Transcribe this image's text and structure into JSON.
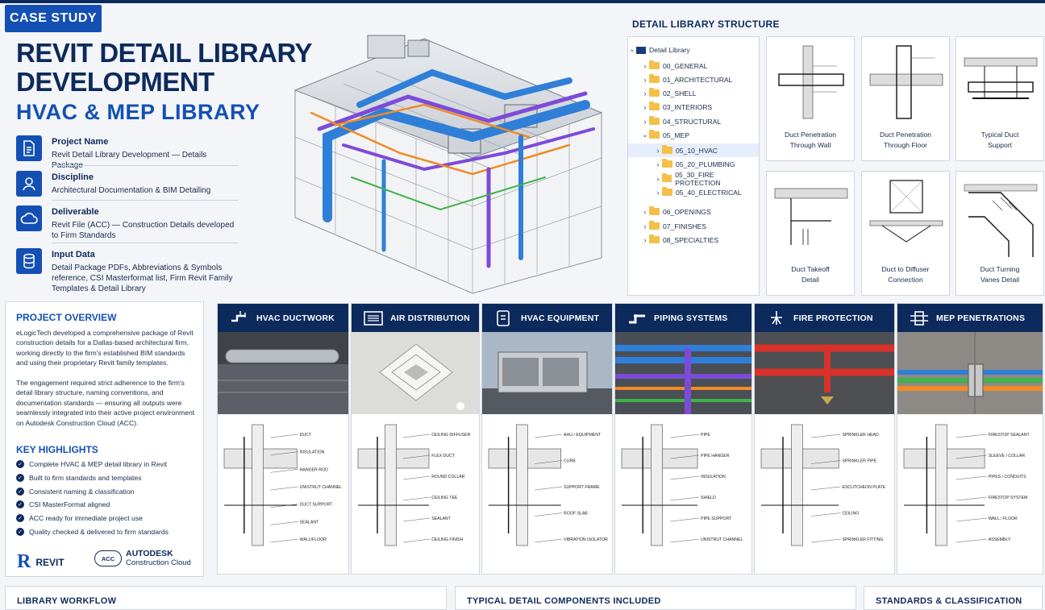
{
  "header": {
    "badge": "CASE STUDY",
    "title_line1": "REVIT DETAIL LIBRARY",
    "title_line2": "DEVELOPMENT",
    "subtitle": "HVAC & MEP LIBRARY"
  },
  "info": [
    {
      "icon": "document-icon",
      "label": "Project Name",
      "value": "Revit Detail Library Development — Details Package"
    },
    {
      "icon": "user-icon",
      "label": "Discipline",
      "value": "Architectural Documentation & BIM Detailing"
    },
    {
      "icon": "cloud-icon",
      "label": "Deliverable",
      "value": "Revit File (ACC) — Construction Details developed to Firm Standards"
    },
    {
      "icon": "database-icon",
      "label": "Input Data",
      "value": "Detail Package PDFs, Abbreviations & Symbols reference, CSI Masterformat list, Firm Revit Family Templates & Detail Library"
    }
  ],
  "library": {
    "title": "DETAIL LIBRARY STRUCTURE",
    "root": "Detail Library",
    "items": [
      {
        "label": "00_GENERAL",
        "level": 1,
        "open": false
      },
      {
        "label": "01_ARCHITECTURAL",
        "level": 1,
        "open": false
      },
      {
        "label": "02_SHELL",
        "level": 1,
        "open": false
      },
      {
        "label": "03_INTERIORS",
        "level": 1,
        "open": false
      },
      {
        "label": "04_STRUCTURAL",
        "level": 1,
        "open": false
      },
      {
        "label": "05_MEP",
        "level": 1,
        "open": true
      },
      {
        "label": "05_10_HVAC",
        "level": 2,
        "open": false,
        "selected": true
      },
      {
        "label": "05_20_PLUMBING",
        "level": 2,
        "open": false
      },
      {
        "label": "05_30_FIRE PROTECTION",
        "level": 2,
        "open": false
      },
      {
        "label": "05_40_ELECTRICAL",
        "level": 2,
        "open": false
      },
      {
        "label": "06_OPENINGS",
        "level": 1,
        "open": false
      },
      {
        "label": "07_FINISHES",
        "level": 1,
        "open": false
      },
      {
        "label": "08_SPECIALTIES",
        "level": 1,
        "open": false
      }
    ],
    "details": [
      {
        "line1": "Duct Penetration",
        "line2": "Through Wall"
      },
      {
        "line1": "Duct Penetration",
        "line2": "Through Floor"
      },
      {
        "line1": "Typical Duct",
        "line2": "Support"
      },
      {
        "line1": "Duct Takeoff",
        "line2": "Detail"
      },
      {
        "line1": "Duct to Diffuser",
        "line2": "Connection"
      },
      {
        "line1": "Duct Turning",
        "line2": "Vanes Detail"
      }
    ]
  },
  "overview": {
    "title": "PROJECT OVERVIEW",
    "para1": "eLogicTech developed a comprehensive package of Revit construction details for a Dallas-based architectural firm, working directly to the firm's established BIM standards and using their proprietary Revit family templates.",
    "para2": "The engagement required strict adherence to the firm's detail library structure, naming conventions, and documentation standards — ensuring all outputs were seamlessly integrated into their active project environment on Autodesk Construction Cloud (ACC).",
    "highlights_title": "KEY HIGHLIGHTS",
    "highlights": [
      "Complete HVAC & MEP detail library in Revit",
      "Built to firm standards and templates",
      "Consistent naming & classification",
      "CSI MasterFormat aligned",
      "ACC ready for immediate project use",
      "Quality checked & delivered to firm standards"
    ],
    "revit_logo": "REVIT",
    "acc_badge": "ACC",
    "autodesk_line1": "AUTODESK",
    "autodesk_line2": "Construction Cloud"
  },
  "categories": [
    {
      "title": "HVAC DUCTWORK",
      "icon": "duct-icon",
      "labels": [
        "DUCT",
        "INSULATION",
        "HANGER ROD",
        "UNISTRUT CHANNEL",
        "DUCT SUPPORT",
        "SEALANT",
        "WALL/FLOOR"
      ]
    },
    {
      "title": "AIR DISTRIBUTION",
      "icon": "diffuser-icon",
      "labels": [
        "CEILING DIFFUSER",
        "FLEX DUCT",
        "ROUND COLLAR",
        "CEILING TEE",
        "SEALANT",
        "CEILING FINISH"
      ]
    },
    {
      "title": "HVAC EQUIPMENT",
      "icon": "equipment-icon",
      "labels": [
        "AHU / EQUIPMENT",
        "CURB",
        "SUPPORT FRAME",
        "ROOF SLAB",
        "VIBRATION ISOLATOR"
      ]
    },
    {
      "title": "PIPING SYSTEMS",
      "icon": "pipe-icon",
      "labels": [
        "PIPE",
        "PIPE HANGER",
        "INSULATION",
        "SHIELD",
        "PIPE SUPPORT",
        "UNISTRUT CHANNEL"
      ]
    },
    {
      "title": "FIRE PROTECTION",
      "icon": "sprinkler-icon",
      "labels": [
        "SPRINKLER HEAD",
        "SPRINKLER PIPE",
        "ESCUTCHEON PLATE",
        "CEILING",
        "SPRINKLER FITTING"
      ]
    },
    {
      "title": "MEP PENETRATIONS",
      "icon": "penetration-icon",
      "labels": [
        "FIRESTOP SEALANT",
        "SLEEVE / COLLAR",
        "PIPES / CONDUITS",
        "FIRESTOP SYSTEM",
        "WALL / FLOOR",
        "ASSEMBLY"
      ]
    }
  ],
  "bottom": {
    "workflow": "LIBRARY WORKFLOW",
    "components": "TYPICAL DETAIL COMPONENTS INCLUDED",
    "standards": "STANDARDS & CLASSIFICATION"
  },
  "colors": {
    "navy": "#0d2a5c",
    "blue": "#1450b4",
    "pipe_blue": "#2f7fd8",
    "pipe_purple": "#7c4bd8",
    "pipe_orange": "#f08a24",
    "fire_red": "#d8322a"
  }
}
